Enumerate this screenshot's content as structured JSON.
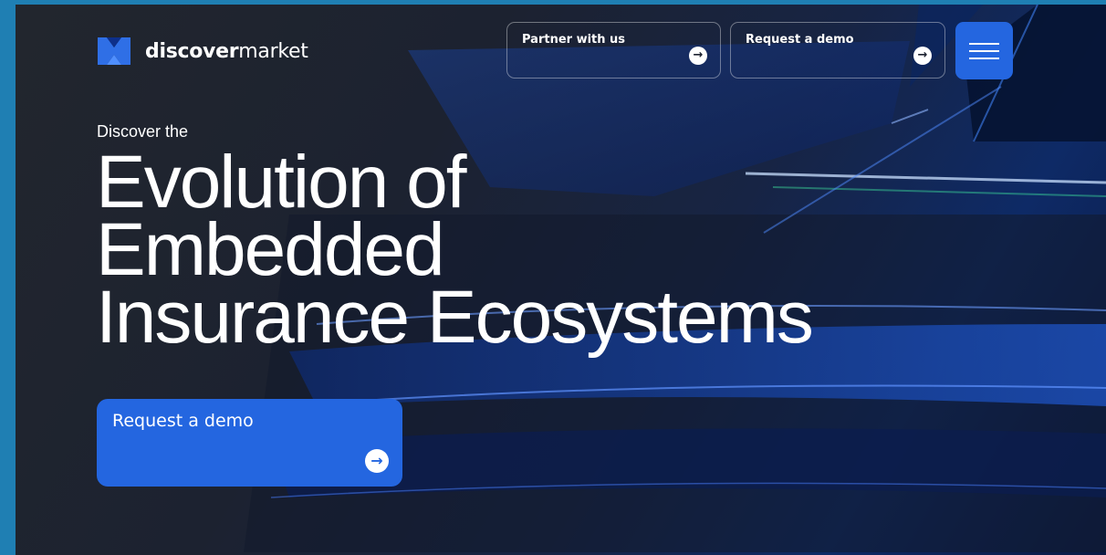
{
  "brand": {
    "name_bold": "discover",
    "name_regular": "market",
    "logo_icon": "dm-logo-icon"
  },
  "nav": {
    "partner_label": "Partner with us",
    "demo_label": "Request a demo",
    "arrow": "→",
    "menu_icon": "hamburger-icon"
  },
  "hero": {
    "eyebrow": "Discover the",
    "headline_lines": [
      "Evolution of",
      "Embedded",
      "Insurance Ecosystems"
    ],
    "cta_label": "Request a demo",
    "cta_arrow": "→"
  },
  "colors": {
    "accent": "#2466e0",
    "page_border": "#1f7fb3",
    "background_dark": "#1c2230"
  }
}
